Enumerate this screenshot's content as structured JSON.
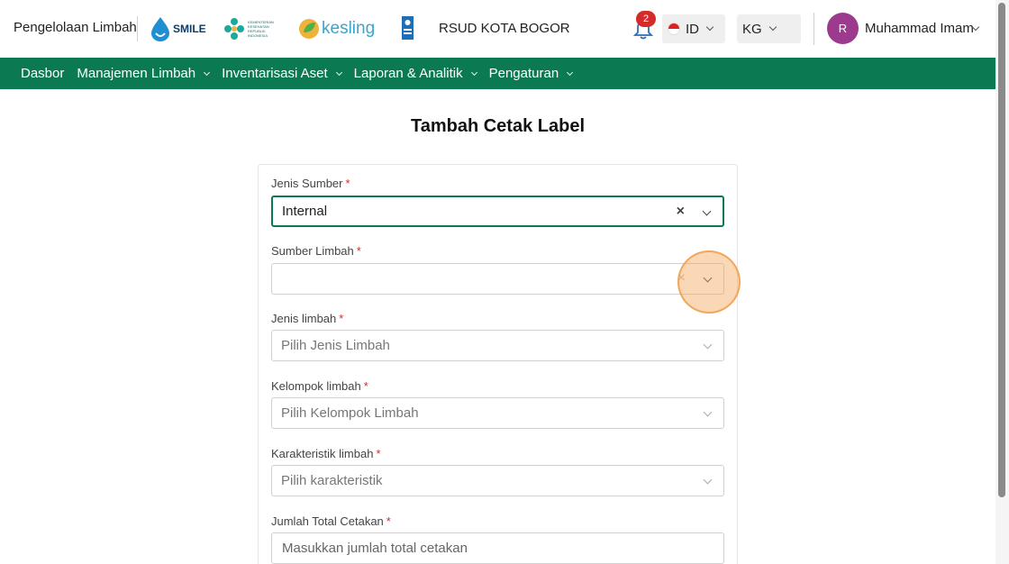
{
  "header": {
    "app_title": "Pengelolaan Limbah",
    "logos": [
      {
        "name": "smile-logo",
        "text": "SMILE"
      },
      {
        "name": "kemenkes-logo",
        "text": "KEMENTERIAN KESEHATAN REPUBLIK INDONESIA"
      },
      {
        "name": "kesling-logo",
        "text": "kesling"
      },
      {
        "name": "undp-logo",
        "text": "UNDP"
      }
    ],
    "hospital": "RSUD KOTA BOGOR",
    "notification_count": "2",
    "language": "ID",
    "unit": "KG",
    "user_initial": "R",
    "user_name": "Muhammad Imam"
  },
  "nav": {
    "items": [
      {
        "label": "Dasbor",
        "dropdown": false
      },
      {
        "label": "Manajemen Limbah",
        "dropdown": true
      },
      {
        "label": "Inventarisasi Aset",
        "dropdown": true
      },
      {
        "label": "Laporan & Analitik",
        "dropdown": true
      },
      {
        "label": "Pengaturan",
        "dropdown": true
      }
    ]
  },
  "page": {
    "title": "Tambah Cetak Label"
  },
  "form": {
    "jenis_sumber": {
      "label": "Jenis Sumber",
      "required": "*",
      "value": "Internal"
    },
    "sumber_limbah": {
      "label": "Sumber Limbah",
      "required": "*",
      "value": ""
    },
    "jenis_limbah": {
      "label": "Jenis limbah",
      "required": "*",
      "placeholder": "Pilih Jenis Limbah"
    },
    "kelompok_limbah": {
      "label": "Kelompok limbah",
      "required": "*",
      "placeholder": "Pilih Kelompok Limbah"
    },
    "karakteristik_limbah": {
      "label": "Karakteristik limbah",
      "required": "*",
      "placeholder": "Pilih karakteristik"
    },
    "jumlah_total_cetakan": {
      "label": "Jumlah Total Cetakan",
      "required": "*",
      "placeholder": "Masukkan jumlah total cetakan"
    }
  },
  "colors": {
    "brand_green": "#0b7a52",
    "badge_red": "#d42a2a",
    "avatar_purple": "#9c3a8e",
    "click_highlight": "#f5a65a"
  }
}
